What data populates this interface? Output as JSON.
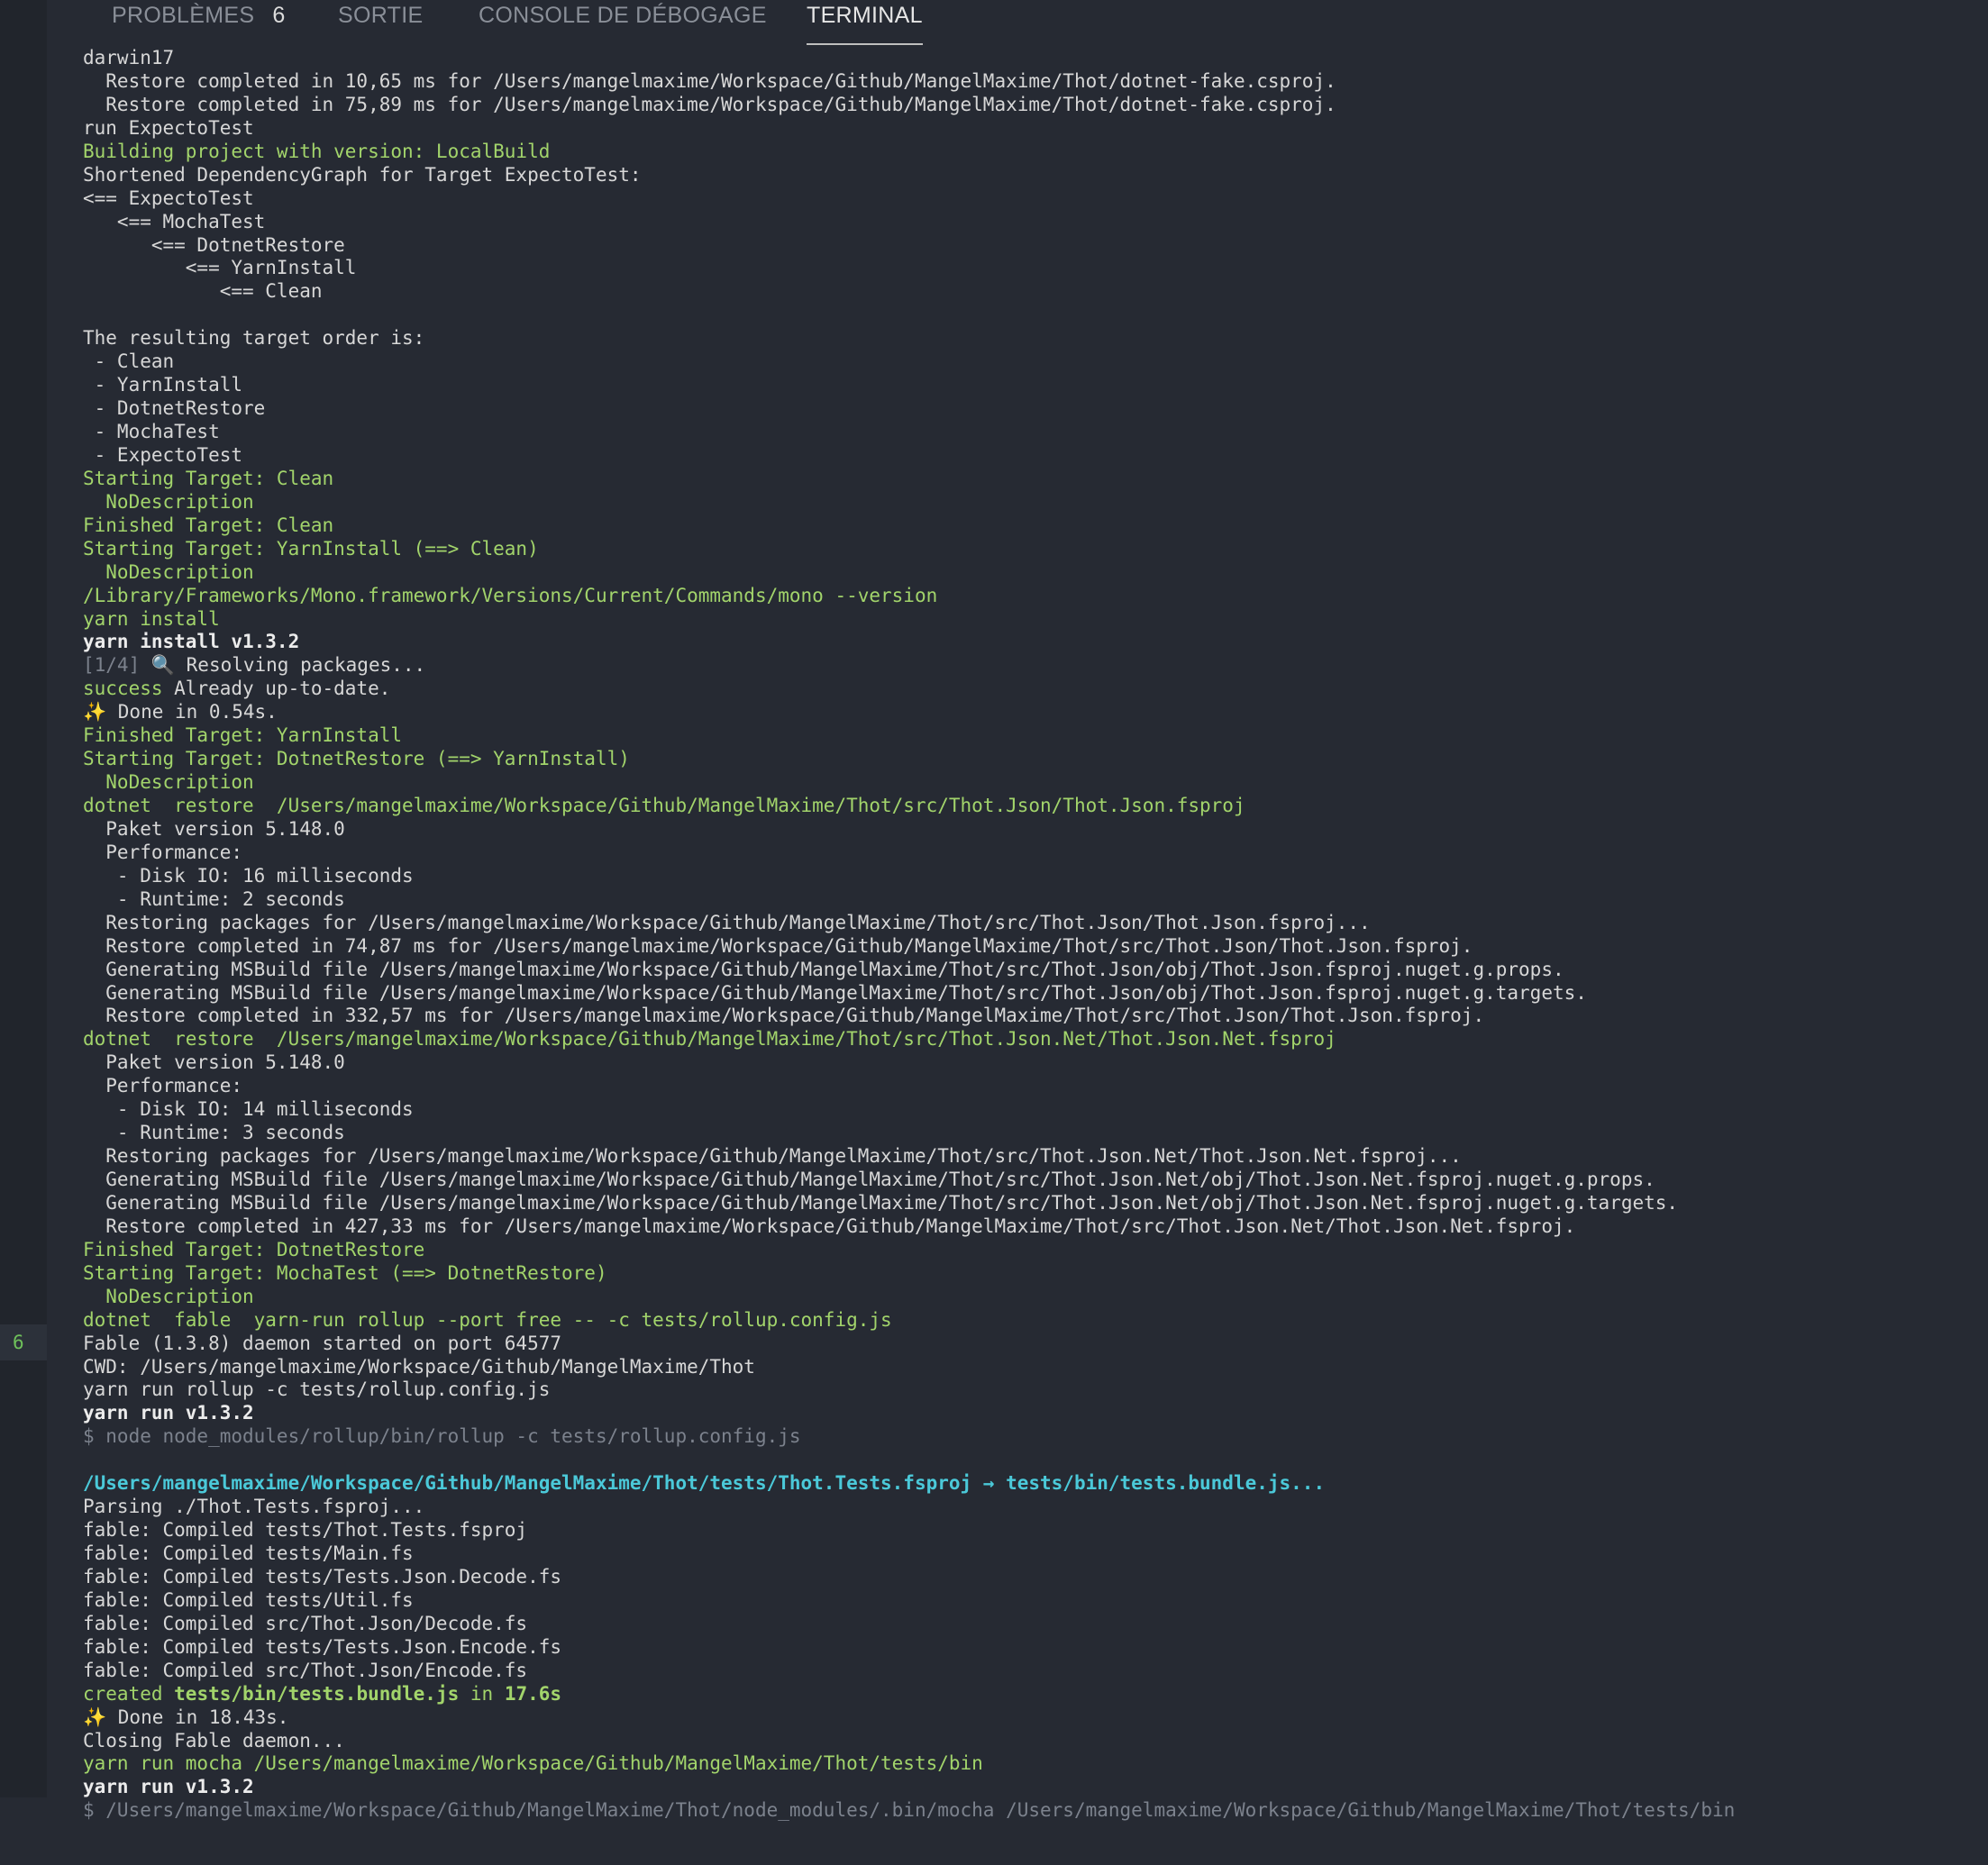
{
  "panel": {
    "tabs": [
      {
        "label": "PROBLÈMES",
        "count": "6"
      },
      {
        "label": "SORTIE"
      },
      {
        "label": "CONSOLE DE DÉBOGAGE"
      },
      {
        "label": "TERMINAL"
      }
    ],
    "active_tab": "TERMINAL",
    "gutter_badge": "6"
  },
  "terminal": {
    "lines": [
      [
        {
          "t": "darwin17"
        }
      ],
      [
        {
          "t": "  Restore completed in 10,65 ms for /Users/mangelmaxime/Workspace/Github/MangelMaxime/Thot/dotnet-fake.csproj."
        }
      ],
      [
        {
          "t": "  Restore completed in 75,89 ms for /Users/mangelmaxime/Workspace/Github/MangelMaxime/Thot/dotnet-fake.csproj."
        }
      ],
      [
        {
          "t": "run ExpectoTest"
        }
      ],
      [
        {
          "t": "Building project with version: LocalBuild",
          "s": "green"
        }
      ],
      [
        {
          "t": "Shortened DependencyGraph for Target ExpectoTest:"
        }
      ],
      [
        {
          "t": "<== ExpectoTest"
        }
      ],
      [
        {
          "t": "   <== MochaTest"
        }
      ],
      [
        {
          "t": "      <== DotnetRestore"
        }
      ],
      [
        {
          "t": "         <== YarnInstall"
        }
      ],
      [
        {
          "t": "            <== Clean"
        }
      ],
      [
        {
          "t": ""
        }
      ],
      [
        {
          "t": "The resulting target order is:"
        }
      ],
      [
        {
          "t": " - Clean"
        }
      ],
      [
        {
          "t": " - YarnInstall"
        }
      ],
      [
        {
          "t": " - DotnetRestore"
        }
      ],
      [
        {
          "t": " - MochaTest"
        }
      ],
      [
        {
          "t": " - ExpectoTest"
        }
      ],
      [
        {
          "t": "Starting Target: Clean",
          "s": "green"
        }
      ],
      [
        {
          "t": "  NoDescription",
          "s": "green"
        }
      ],
      [
        {
          "t": "Finished Target: Clean",
          "s": "green"
        }
      ],
      [
        {
          "t": "Starting Target: YarnInstall (==> Clean)",
          "s": "green"
        }
      ],
      [
        {
          "t": "  NoDescription",
          "s": "green"
        }
      ],
      [
        {
          "t": "/Library/Frameworks/Mono.framework/Versions/Current/Commands/mono --version",
          "s": "green"
        }
      ],
      [
        {
          "t": "yarn install",
          "s": "green"
        }
      ],
      [
        {
          "t": "yarn install v1.3.2",
          "s": "white bold"
        }
      ],
      [
        {
          "t": "[1/4]",
          "s": "dim"
        },
        {
          "t": " 🔍 Resolving packages..."
        }
      ],
      [
        {
          "t": "success",
          "s": "green"
        },
        {
          "t": " Already up-to-date."
        }
      ],
      [
        {
          "t": "✨ Done in 0.54s."
        }
      ],
      [
        {
          "t": "Finished Target: YarnInstall",
          "s": "green"
        }
      ],
      [
        {
          "t": "Starting Target: DotnetRestore (==> YarnInstall)",
          "s": "green"
        }
      ],
      [
        {
          "t": "  NoDescription",
          "s": "green"
        }
      ],
      [
        {
          "t": "dotnet  restore  /Users/mangelmaxime/Workspace/Github/MangelMaxime/Thot/src/Thot.Json/Thot.Json.fsproj",
          "s": "green"
        }
      ],
      [
        {
          "t": "  Paket version 5.148.0"
        }
      ],
      [
        {
          "t": "  Performance:"
        }
      ],
      [
        {
          "t": "   - Disk IO: 16 milliseconds"
        }
      ],
      [
        {
          "t": "   - Runtime: 2 seconds"
        }
      ],
      [
        {
          "t": "  Restoring packages for /Users/mangelmaxime/Workspace/Github/MangelMaxime/Thot/src/Thot.Json/Thot.Json.fsproj..."
        }
      ],
      [
        {
          "t": "  Restore completed in 74,87 ms for /Users/mangelmaxime/Workspace/Github/MangelMaxime/Thot/src/Thot.Json/Thot.Json.fsproj."
        }
      ],
      [
        {
          "t": "  Generating MSBuild file /Users/mangelmaxime/Workspace/Github/MangelMaxime/Thot/src/Thot.Json/obj/Thot.Json.fsproj.nuget.g.props."
        }
      ],
      [
        {
          "t": "  Generating MSBuild file /Users/mangelmaxime/Workspace/Github/MangelMaxime/Thot/src/Thot.Json/obj/Thot.Json.fsproj.nuget.g.targets."
        }
      ],
      [
        {
          "t": "  Restore completed in 332,57 ms for /Users/mangelmaxime/Workspace/Github/MangelMaxime/Thot/src/Thot.Json/Thot.Json.fsproj."
        }
      ],
      [
        {
          "t": "dotnet  restore  /Users/mangelmaxime/Workspace/Github/MangelMaxime/Thot/src/Thot.Json.Net/Thot.Json.Net.fsproj",
          "s": "green"
        }
      ],
      [
        {
          "t": "  Paket version 5.148.0"
        }
      ],
      [
        {
          "t": "  Performance:"
        }
      ],
      [
        {
          "t": "   - Disk IO: 14 milliseconds"
        }
      ],
      [
        {
          "t": "   - Runtime: 3 seconds"
        }
      ],
      [
        {
          "t": "  Restoring packages for /Users/mangelmaxime/Workspace/Github/MangelMaxime/Thot/src/Thot.Json.Net/Thot.Json.Net.fsproj..."
        }
      ],
      [
        {
          "t": "  Generating MSBuild file /Users/mangelmaxime/Workspace/Github/MangelMaxime/Thot/src/Thot.Json.Net/obj/Thot.Json.Net.fsproj.nuget.g.props."
        }
      ],
      [
        {
          "t": "  Generating MSBuild file /Users/mangelmaxime/Workspace/Github/MangelMaxime/Thot/src/Thot.Json.Net/obj/Thot.Json.Net.fsproj.nuget.g.targets."
        }
      ],
      [
        {
          "t": "  Restore completed in 427,33 ms for /Users/mangelmaxime/Workspace/Github/MangelMaxime/Thot/src/Thot.Json.Net/Thot.Json.Net.fsproj."
        }
      ],
      [
        {
          "t": "Finished Target: DotnetRestore",
          "s": "green"
        }
      ],
      [
        {
          "t": "Starting Target: MochaTest (==> DotnetRestore)",
          "s": "green"
        }
      ],
      [
        {
          "t": "  NoDescription",
          "s": "green"
        }
      ],
      [
        {
          "t": "dotnet  fable  yarn-run rollup --port free -- -c tests/rollup.config.js",
          "s": "green"
        }
      ],
      [
        {
          "t": "Fable (1.3.8) daemon started on port 64577"
        }
      ],
      [
        {
          "t": "CWD: /Users/mangelmaxime/Workspace/Github/MangelMaxime/Thot"
        }
      ],
      [
        {
          "t": "yarn run rollup -c tests/rollup.config.js"
        }
      ],
      [
        {
          "t": "yarn run v1.3.2",
          "s": "white bold"
        }
      ],
      [
        {
          "t": "$ node node_modules/rollup/bin/rollup -c tests/rollup.config.js",
          "s": "dim"
        }
      ],
      [
        {
          "t": ""
        }
      ],
      [
        {
          "t": "/Users/mangelmaxime/Workspace/Github/MangelMaxime/Thot/tests/Thot.Tests.fsproj → tests/bin/tests.bundle.js...",
          "s": "cyan bold"
        }
      ],
      [
        {
          "t": "Parsing ./Thot.Tests.fsproj..."
        }
      ],
      [
        {
          "t": "fable: Compiled tests/Thot.Tests.fsproj"
        }
      ],
      [
        {
          "t": "fable: Compiled tests/Main.fs"
        }
      ],
      [
        {
          "t": "fable: Compiled tests/Tests.Json.Decode.fs"
        }
      ],
      [
        {
          "t": "fable: Compiled tests/Util.fs"
        }
      ],
      [
        {
          "t": "fable: Compiled src/Thot.Json/Decode.fs"
        }
      ],
      [
        {
          "t": "fable: Compiled tests/Tests.Json.Encode.fs"
        }
      ],
      [
        {
          "t": "fable: Compiled src/Thot.Json/Encode.fs"
        }
      ],
      [
        {
          "t": "created ",
          "s": "green"
        },
        {
          "t": "tests/bin/tests.bundle.js",
          "s": "green bold"
        },
        {
          "t": " in ",
          "s": "green"
        },
        {
          "t": "17.6s",
          "s": "green bold"
        }
      ],
      [
        {
          "t": "✨ Done in 18.43s."
        }
      ],
      [
        {
          "t": "Closing Fable daemon..."
        }
      ],
      [
        {
          "t": "yarn run mocha /Users/mangelmaxime/Workspace/Github/MangelMaxime/Thot/tests/bin",
          "s": "green"
        }
      ],
      [
        {
          "t": "yarn run v1.3.2",
          "s": "white bold"
        }
      ],
      [
        {
          "t": "$ /Users/mangelmaxime/Workspace/Github/MangelMaxime/Thot/node_modules/.bin/mocha /Users/mangelmaxime/Workspace/Github/MangelMaxime/Thot/tests/bin",
          "s": "dim"
        }
      ]
    ]
  },
  "colors": {
    "background": "#262a33",
    "text": "#d7d7d7",
    "green": "#a2d46b",
    "cyan": "#4bc9d9",
    "dim": "#7c828d"
  }
}
